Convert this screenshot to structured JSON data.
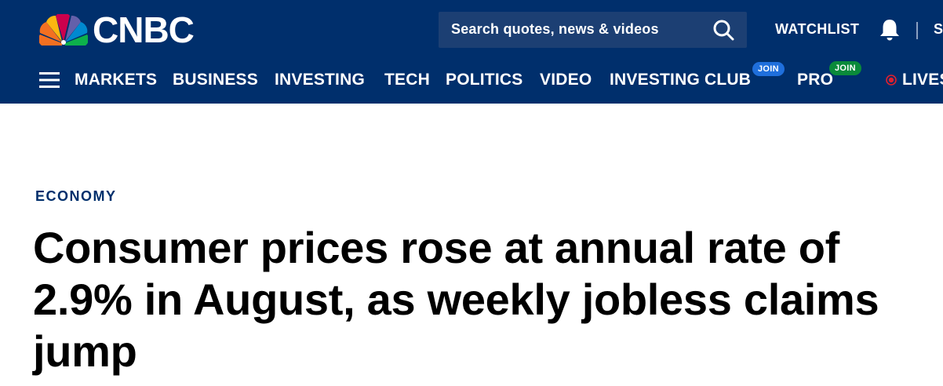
{
  "brand": {
    "name": "CNBC"
  },
  "header": {
    "search_placeholder": "Search quotes, news & videos",
    "watchlist_label": "WATCHLIST",
    "cut_label": "S"
  },
  "nav": {
    "items": [
      {
        "label": "MARKETS"
      },
      {
        "label": "BUSINESS"
      },
      {
        "label": "INVESTING"
      },
      {
        "label": "TECH"
      },
      {
        "label": "POLITICS"
      },
      {
        "label": "VIDEO"
      },
      {
        "label": "INVESTING CLUB",
        "badge": "JOIN"
      },
      {
        "label": "PRO",
        "badge": "JOIN"
      },
      {
        "label": "LIVES"
      }
    ]
  },
  "article": {
    "category": "ECONOMY",
    "headline": "Consumer prices rose at annual rate of 2.9% in August, as weekly jobless claims jump"
  },
  "colors": {
    "header_bg": "#002f6c",
    "search_bg": "#1c3f73",
    "club_badge": "#1f6fdc",
    "pro_badge": "#0a8a3a",
    "live_red": "#e0202e",
    "category": "#002f6c"
  },
  "icons": [
    "peacock-logo-icon",
    "search-icon",
    "bell-icon",
    "hamburger-menu-icon",
    "live-dot-icon"
  ]
}
